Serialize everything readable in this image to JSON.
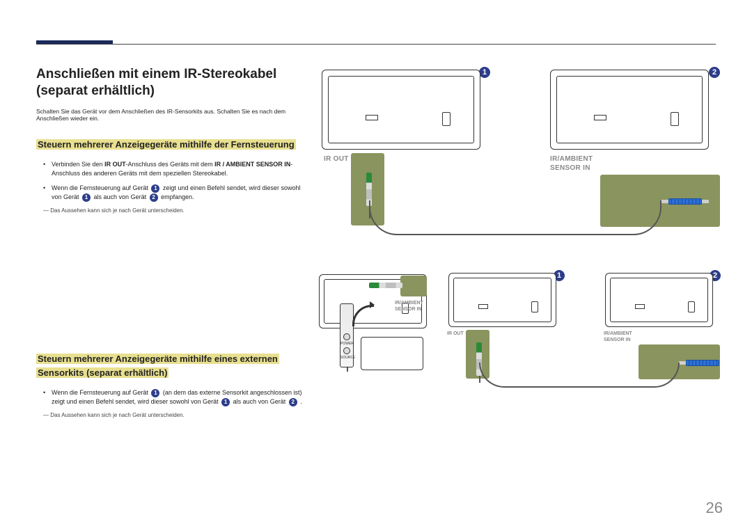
{
  "page_number": "26",
  "title": "Anschließen mit einem IR-Stereokabel (separat erhältlich)",
  "intro": "Schalten Sie das Gerät vor dem Anschließen des IR-Sensorkits aus. Schalten Sie es nach dem Anschließen wieder ein.",
  "section1": {
    "heading": "Steuern mehrerer Anzeigegeräte mithilfe der Fernsteuerung",
    "bullet1_a": "Verbinden Sie den ",
    "bullet1_b": "IR OUT",
    "bullet1_c": "-Anschluss des Geräts mit dem ",
    "bullet1_d": "IR / AMBIENT SENSOR IN",
    "bullet1_e": "-Anschluss des anderen Geräts mit dem speziellen Stereokabel.",
    "bullet2_a": "Wenn die Fernsteuerung auf Gerät ",
    "bullet2_b": " zeigt und einen Befehl sendet, wird dieser sowohl von Gerät ",
    "bullet2_c": " als auch von Gerät ",
    "bullet2_d": " empfangen.",
    "note": "Das Aussehen kann sich je nach Gerät unterscheiden."
  },
  "section2": {
    "heading": "Steuern mehrerer Anzeigegeräte mithilfe eines externen Sensorkits (separat erhältlich)",
    "bullet1_a": "Wenn die Fernsteuerung auf Gerät ",
    "bullet1_b": " (an dem das externe Sensorkit angeschlossen ist) zeigt und einen Befehl sendet, wird dieser sowohl von Gerät ",
    "bullet1_c": " als auch von Gerät ",
    "bullet1_d": " .",
    "note": "Das Aussehen kann sich je nach Gerät unterscheiden."
  },
  "labels": {
    "ir_out": "IR OUT",
    "ir_ambient": "IR/AMBIENT",
    "sensor_in": "SENSOR IN",
    "power": "POWER",
    "source": "SOURCE"
  },
  "badges": {
    "one": "1",
    "two": "2"
  }
}
